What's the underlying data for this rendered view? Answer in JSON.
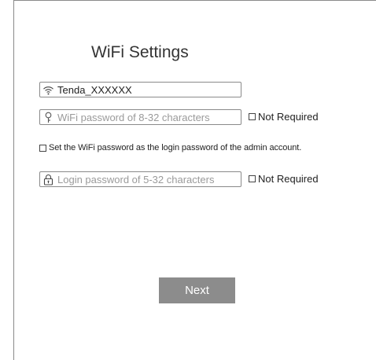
{
  "page": {
    "title": "WiFi Settings"
  },
  "wifi_name": {
    "value": "Tenda_XXXXXX"
  },
  "wifi_password": {
    "placeholder": "WiFi password of 8-32 characters",
    "not_required_label": "Not Required"
  },
  "same_password": {
    "label": "Set the WiFi password as the login password of the admin account."
  },
  "login_password": {
    "placeholder": "Login password of 5-32 characters",
    "not_required_label": "Not Required"
  },
  "actions": {
    "next_label": "Next"
  },
  "colors": {
    "button_bg": "#8c8c8c",
    "border": "#8a8a8a",
    "placeholder": "#9a9a9a"
  }
}
